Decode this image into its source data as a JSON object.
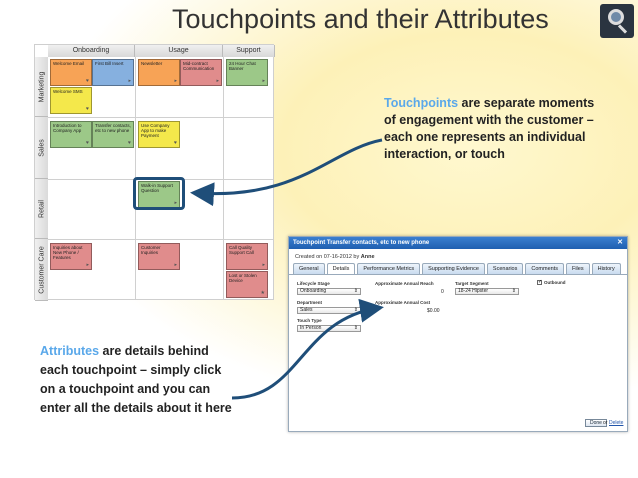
{
  "slide": {
    "title": "Touchpoints and their Attributes",
    "callout_touchpoints_keyword": "Touchpoints",
    "callout_touchpoints_rest": " are separate moments of engagement with the customer – each one represents an individual interaction, or touch",
    "callout_attributes_keyword": "Attributes",
    "callout_attributes_rest": " are details behind each touchpoint – simply click on a touchpoint and you can enter all the details about it here",
    "keyword_color": "#5aa8ea"
  },
  "board": {
    "columns": [
      "Onboarding",
      "Usage",
      "Support"
    ],
    "rows": [
      "Marketing",
      "Sales",
      "Retail",
      "Customer Care"
    ],
    "cards": {
      "welcome_email": "Welcome Email",
      "first_bill_insert": "First Bill Insert",
      "newsletter": "Newsletter",
      "mid_contract": "Mid-contract Communication",
      "chat_banner": "24 Hour Chat Banner",
      "welcome_sms": "Welcome SMS",
      "intro_app": "Introduction to Company App",
      "transfer_contacts": "Transfer contacts, etc to new phone",
      "use_app": "Use Company App to make Payment",
      "walkin_support": "Walk-in Support Question",
      "inquiries_phone": "Inquiries about New Phone / Features",
      "customer_inquiries": "Customer Inquiries",
      "quality_call": "Call Quality Support Call",
      "lost_device": "Lost or Stolen Device"
    }
  },
  "dialog": {
    "title": "Touchpoint Transfer contacts, etc to new phone",
    "created_prefix": "Created on 07-16-2012 by ",
    "created_by": "Anne",
    "tabs": [
      "General",
      "Details",
      "Performance Metrics",
      "Supporting Evidence",
      "Scenarios",
      "Comments",
      "Files",
      "History"
    ],
    "active_tab": "Details",
    "fields": {
      "lifecycle_stage_label": "Lifecycle Stage",
      "lifecycle_stage_value": "Onboarding",
      "annual_reach_label": "Approximate Annual Reach",
      "annual_reach_value": "0",
      "target_segment_label": "Target Segment",
      "target_segment_value": "18-24 Hipster",
      "outbound_label": "Outbound",
      "outbound_checked": true,
      "department_label": "Department",
      "department_value": "Sales",
      "annual_cost_label": "Approximate Annual Cost",
      "annual_cost_value": "$0.00",
      "touch_type_label": "Touch Type",
      "touch_type_value": "In Person"
    },
    "done_label": "Done",
    "or_text": "or",
    "delete_label": "Delete"
  },
  "colors": {
    "orange": "#f7a356",
    "blue": "#86b0df",
    "yellow": "#f4e84b",
    "green": "#9cc888",
    "red": "#e08c8c",
    "highlight": "#1f4e79"
  }
}
